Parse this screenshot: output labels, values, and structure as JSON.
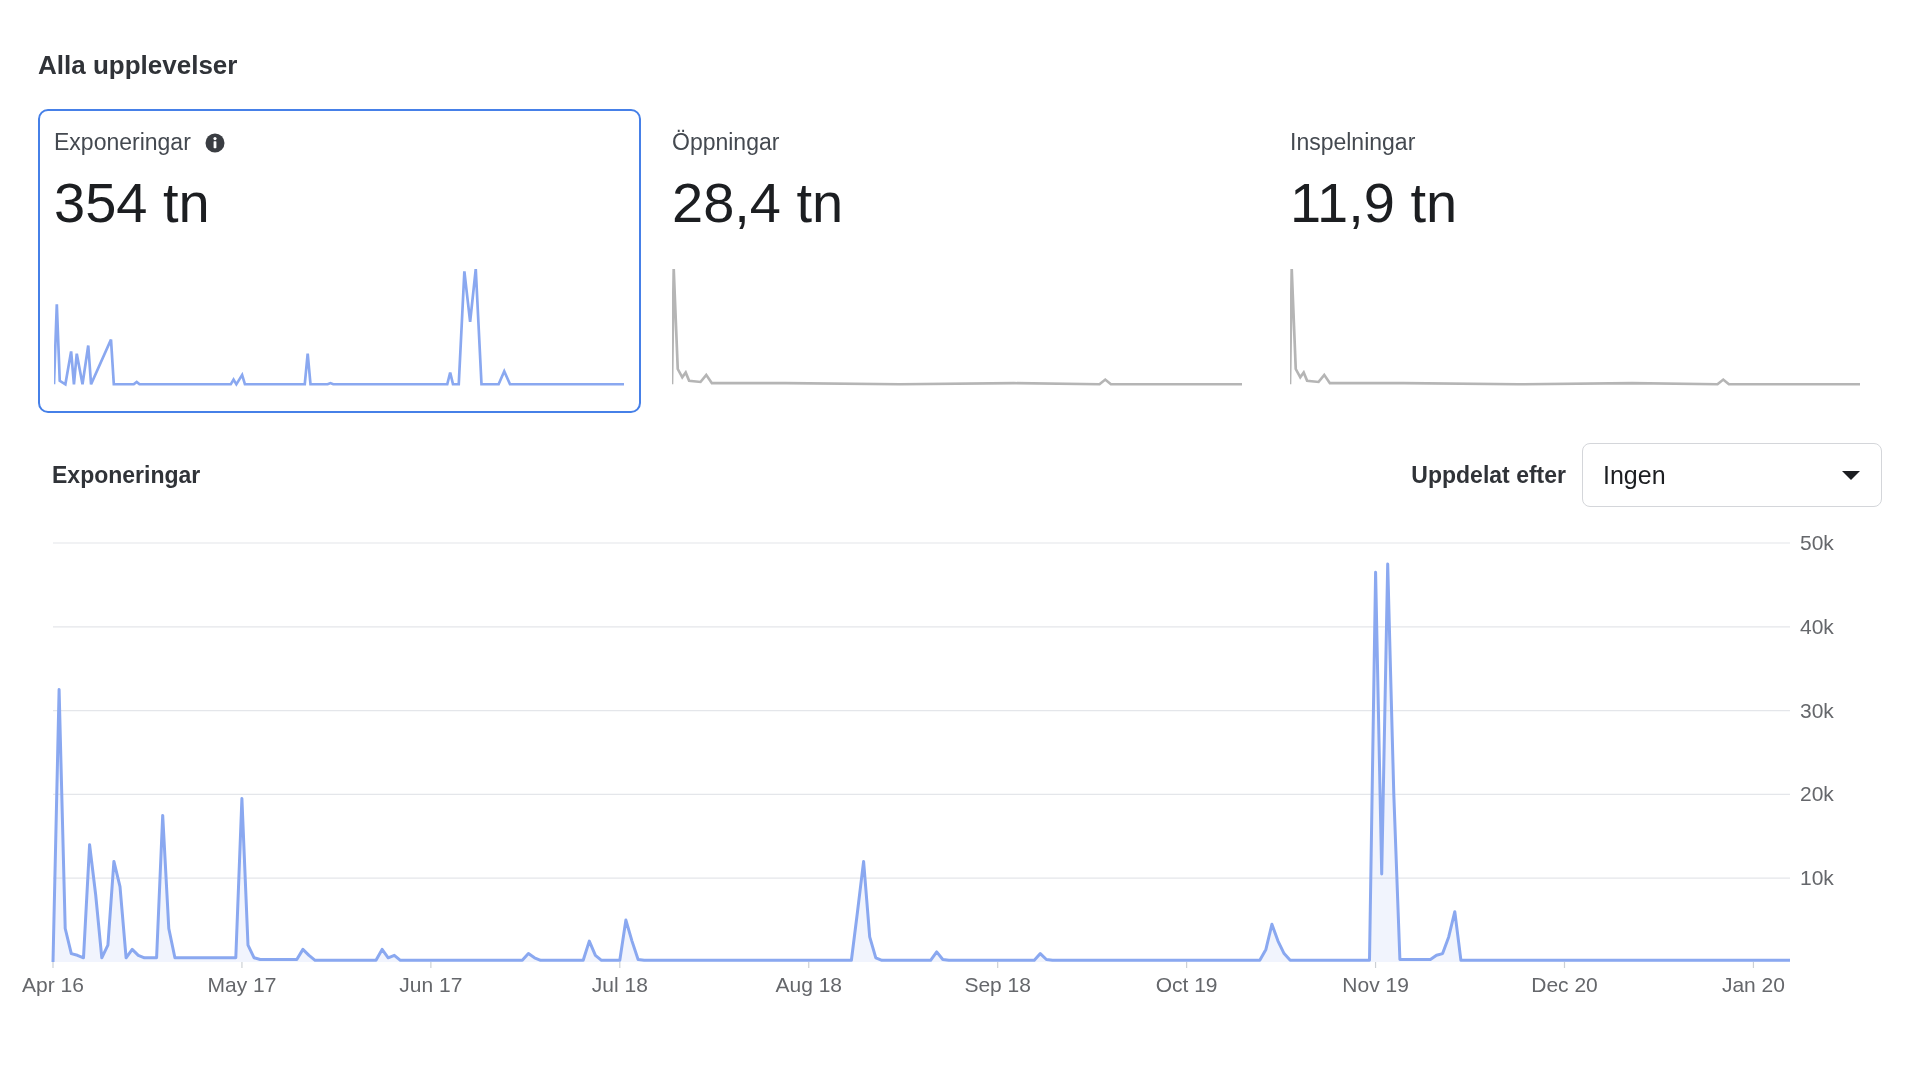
{
  "title": "Alla upplevelser",
  "metrics": [
    {
      "label": "Exponeringar",
      "value": "354 tn",
      "selected": true,
      "info": true
    },
    {
      "label": "Öppningar",
      "value": "28,4 tn",
      "selected": false,
      "info": false
    },
    {
      "label": "Inspelningar",
      "value": "11,9 tn",
      "selected": false,
      "info": false
    }
  ],
  "chart_section": {
    "breakdown_label": "Uppdelat efter",
    "breakdown_value": "Ingen",
    "chart_data": {
      "type": "area",
      "title": "Exponeringar",
      "categories": [
        "Apr 16",
        null,
        null,
        null,
        null,
        null,
        null,
        null,
        null,
        null,
        null,
        null,
        null,
        null,
        null,
        null,
        null,
        null,
        null,
        null,
        null,
        null,
        null,
        null,
        null,
        null,
        null,
        null,
        null,
        null,
        null,
        "May 17",
        null,
        null,
        null,
        null,
        null,
        null,
        null,
        null,
        null,
        null,
        null,
        null,
        null,
        null,
        null,
        null,
        null,
        null,
        null,
        null,
        null,
        null,
        null,
        null,
        null,
        null,
        null,
        null,
        null,
        null,
        "Jun 17",
        null,
        null,
        null,
        null,
        null,
        null,
        null,
        null,
        null,
        null,
        null,
        null,
        null,
        null,
        null,
        null,
        null,
        null,
        null,
        null,
        null,
        null,
        null,
        null,
        null,
        null,
        null,
        null,
        null,
        null,
        "Jul 18",
        null,
        null,
        null,
        null,
        null,
        null,
        null,
        null,
        null,
        null,
        null,
        null,
        null,
        null,
        null,
        null,
        null,
        null,
        null,
        null,
        null,
        null,
        null,
        null,
        null,
        null,
        null,
        null,
        null,
        null,
        "Aug 18",
        null,
        null,
        null,
        null,
        null,
        null,
        null,
        null,
        null,
        null,
        null,
        null,
        null,
        null,
        null,
        null,
        null,
        null,
        null,
        null,
        null,
        null,
        null,
        null,
        null,
        null,
        null,
        null,
        null,
        null,
        "Sep 18",
        null,
        null,
        null,
        null,
        null,
        null,
        null,
        null,
        null,
        null,
        null,
        null,
        null,
        null,
        null,
        null,
        null,
        null,
        null,
        null,
        null,
        null,
        null,
        null,
        null,
        null,
        null,
        null,
        null,
        null,
        "Oct 19",
        null,
        null,
        null,
        null,
        null,
        null,
        null,
        null,
        null,
        null,
        null,
        null,
        null,
        null,
        null,
        null,
        null,
        null,
        null,
        null,
        null,
        null,
        null,
        null,
        null,
        null,
        null,
        null,
        null,
        null,
        "Nov 19",
        null,
        null,
        null,
        null,
        null,
        null,
        null,
        null,
        null,
        null,
        null,
        null,
        null,
        null,
        null,
        null,
        null,
        null,
        null,
        null,
        null,
        null,
        null,
        null,
        null,
        null,
        null,
        null,
        null,
        null,
        "Dec 20",
        null,
        null,
        null,
        null,
        null,
        null,
        null,
        null,
        null,
        null,
        null,
        null,
        null,
        null,
        null,
        null,
        null,
        null,
        null,
        null,
        null,
        null,
        null,
        null,
        null,
        null,
        null,
        null,
        null,
        null,
        "Jan 20",
        null,
        null,
        null,
        null,
        null,
        null
      ],
      "series": [
        {
          "color": "#8aa8f0",
          "values": [
            0,
            32500,
            4000,
            1000,
            800,
            500,
            14000,
            8000,
            500,
            2000,
            12000,
            9000,
            500,
            1500,
            800,
            500,
            500,
            500,
            17500,
            4000,
            500,
            500,
            500,
            500,
            500,
            500,
            500,
            500,
            500,
            500,
            500,
            19500,
            2000,
            500,
            300,
            300,
            300,
            300,
            300,
            300,
            300,
            1500,
            800,
            200,
            200,
            200,
            200,
            200,
            200,
            200,
            200,
            200,
            200,
            200,
            1500,
            500,
            800,
            200,
            200,
            200,
            200,
            200,
            200,
            200,
            200,
            200,
            200,
            200,
            200,
            200,
            200,
            200,
            200,
            200,
            200,
            200,
            200,
            200,
            1000,
            500,
            200,
            200,
            200,
            200,
            200,
            200,
            200,
            200,
            2500,
            800,
            200,
            200,
            200,
            200,
            5000,
            2500,
            300,
            200,
            200,
            200,
            200,
            200,
            200,
            200,
            200,
            200,
            200,
            200,
            200,
            200,
            200,
            200,
            200,
            200,
            200,
            200,
            200,
            200,
            200,
            200,
            200,
            200,
            200,
            200,
            200,
            200,
            200,
            200,
            200,
            200,
            200,
            200,
            6000,
            12000,
            3000,
            500,
            200,
            200,
            200,
            200,
            200,
            200,
            200,
            200,
            200,
            1200,
            300,
            200,
            200,
            200,
            200,
            200,
            200,
            200,
            200,
            200,
            200,
            200,
            200,
            200,
            200,
            200,
            1000,
            300,
            200,
            200,
            200,
            200,
            200,
            200,
            200,
            200,
            200,
            200,
            200,
            200,
            200,
            200,
            200,
            200,
            200,
            200,
            200,
            200,
            200,
            200,
            200,
            200,
            200,
            200,
            200,
            200,
            200,
            200,
            200,
            200,
            200,
            200,
            200,
            1500,
            4500,
            2500,
            1000,
            200,
            200,
            200,
            200,
            200,
            200,
            200,
            200,
            200,
            200,
            200,
            200,
            200,
            200,
            46500,
            10500,
            47500,
            20000,
            300,
            300,
            300,
            300,
            300,
            300,
            800,
            1000,
            3000,
            6000,
            200,
            200,
            200,
            200,
            200,
            200,
            200,
            200,
            200,
            200,
            200,
            200,
            200,
            200,
            200,
            200,
            200,
            200,
            200,
            200,
            200,
            200,
            200,
            200,
            200,
            200,
            200,
            200,
            200,
            200,
            200,
            200,
            200,
            200,
            200,
            200,
            200,
            200,
            200,
            200,
            200,
            200,
            200,
            200,
            200,
            200,
            200,
            200,
            200,
            200,
            200,
            200,
            200,
            200,
            200
          ]
        }
      ],
      "ylim": [
        0,
        50000
      ],
      "grid": true,
      "yticks": [
        {
          "value": 10000,
          "label": "10k"
        },
        {
          "value": 20000,
          "label": "20k"
        },
        {
          "value": 30000,
          "label": "30k"
        },
        {
          "value": 40000,
          "label": "40k"
        },
        {
          "value": 50000,
          "label": "50k"
        }
      ]
    }
  }
}
